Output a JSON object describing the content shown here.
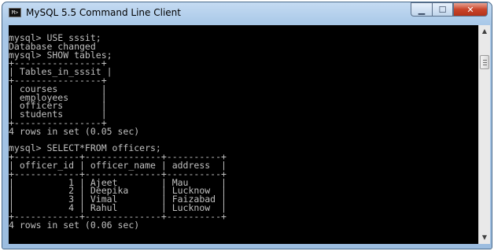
{
  "window": {
    "title": "MySQL 5.5 Command Line Client",
    "icon_text": "M>",
    "controls": {
      "minimize": "▁",
      "maximize": "☐",
      "close": "✕"
    }
  },
  "console": {
    "text": "mysql> USE sssit;\nDatabase changed\nmysql> SHOW tables;\n+----------------+\n| Tables_in_sssit |\n+----------------+\n| courses        |\n| employees      |\n| officers       |\n| students       |\n+----------------+\n4 rows in set (0.05 sec)\n\nmysql> SELECT*FROM officers;\n+------------+--------------+----------+\n| officer_id | officer_name | address  |\n+------------+--------------+----------+\n|          1 | Ajeet        | Mau      |\n|          2 | Deepika      | Lucknow  |\n|          3 | Vimal        | Faizabad |\n|          4 | Rahul        | Lucknow  |\n+------------+--------------+----------+\n4 rows in set (0.06 sec)"
  },
  "scrollbar": {
    "up": "▲",
    "down": "▼"
  }
}
